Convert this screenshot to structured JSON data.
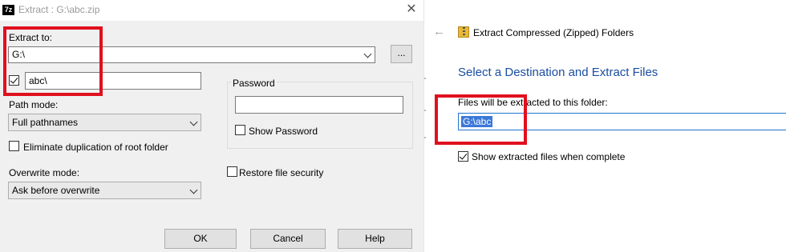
{
  "sevenzip": {
    "app_icon": "7z",
    "window_title": "Extract : G:\\abc.zip",
    "close_glyph": "✕",
    "extract_to_label": "Extract to:",
    "extract_to_value": "G:\\",
    "browse_label": "...",
    "subfolder_checked": true,
    "subfolder_value": "abc\\",
    "path_mode_label": "Path mode:",
    "path_mode_value": "Full pathnames",
    "eliminate_label": "Eliminate duplication of root folder",
    "eliminate_checked": false,
    "overwrite_mode_label": "Overwrite mode:",
    "overwrite_mode_value": "Ask before overwrite",
    "password_label": "Password",
    "password_value": "",
    "show_password_label": "Show Password",
    "show_password_checked": false,
    "restore_security_label": "Restore file security",
    "restore_security_checked": false,
    "ok_label": "OK",
    "cancel_label": "Cancel",
    "help_label": "Help"
  },
  "explorer": {
    "back_glyph": "←",
    "title": "Extract Compressed (Zipped) Folders",
    "heading": "Select a Destination and Extract Files",
    "dest_label": "Files will be extracted to this folder:",
    "dest_value": "G:\\abc",
    "show_files_label": "Show extracted files when complete",
    "show_files_checked": true
  },
  "colors": {
    "annotation": "#e0101e",
    "heading_blue": "#1a4da0",
    "selection_blue": "#3b78d8",
    "focus_border": "#1e75d0"
  }
}
